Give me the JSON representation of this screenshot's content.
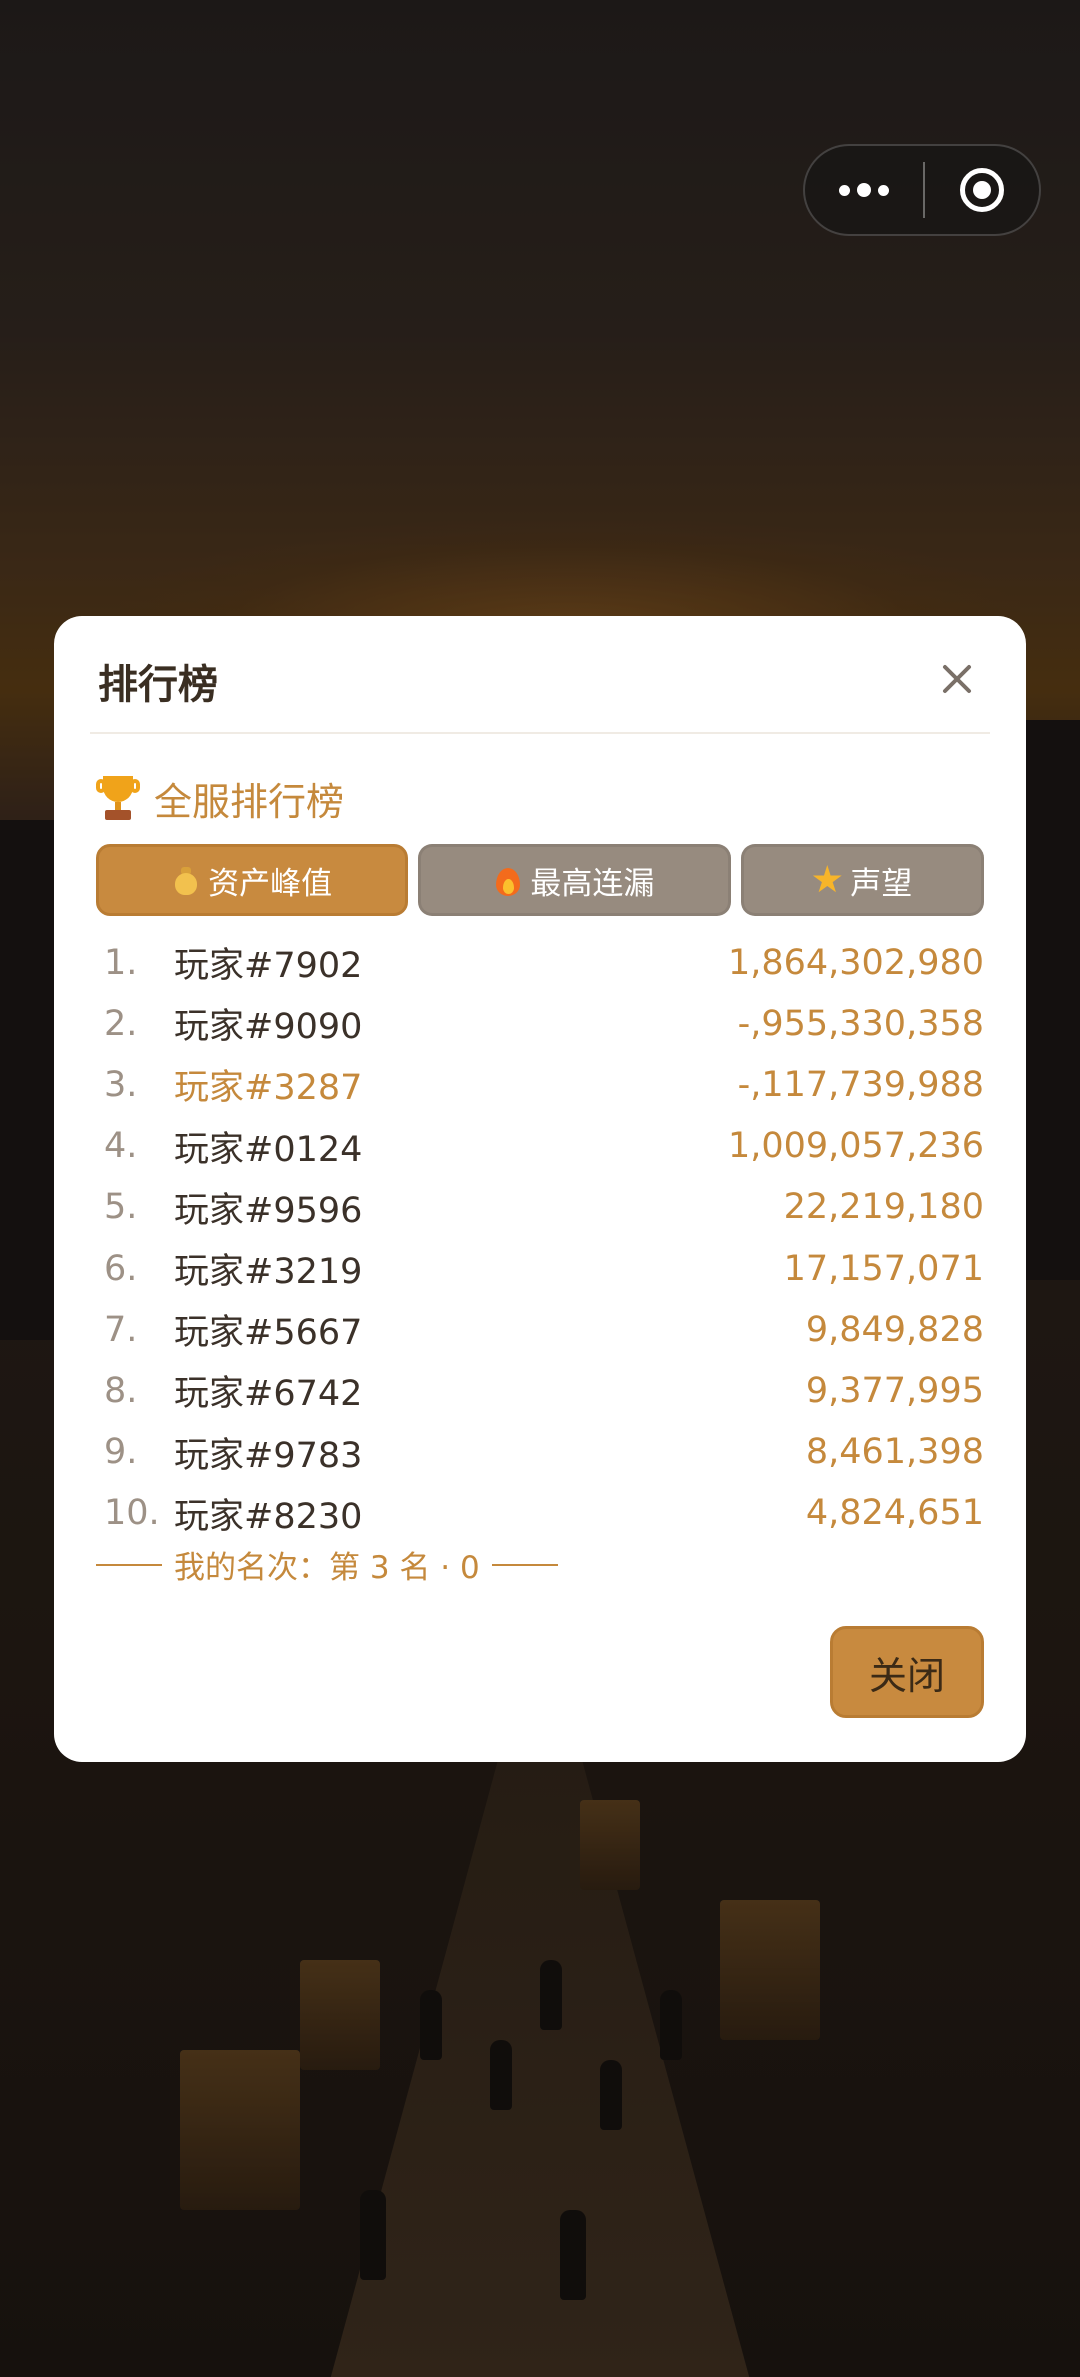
{
  "modal": {
    "title": "排行榜",
    "board_title": "全服排行榜",
    "tabs": [
      {
        "label": "资产峰值",
        "icon": "money-bag-icon",
        "active": true
      },
      {
        "label": "最高连漏",
        "icon": "fire-icon",
        "active": false
      },
      {
        "label": "声望",
        "icon": "star-icon",
        "active": false
      }
    ],
    "rankings": [
      {
        "rank": "1.",
        "player": "玩家#7902",
        "score": "1,864,302,980"
      },
      {
        "rank": "2.",
        "player": "玩家#9090",
        "score": "-,955,330,358"
      },
      {
        "rank": "3.",
        "player": "玩家#3287",
        "score": "-,117,739,988",
        "is_me": true
      },
      {
        "rank": "4.",
        "player": "玩家#0124",
        "score": "1,009,057,236"
      },
      {
        "rank": "5.",
        "player": "玩家#9596",
        "score": "22,219,180"
      },
      {
        "rank": "6.",
        "player": "玩家#3219",
        "score": "17,157,071"
      },
      {
        "rank": "7.",
        "player": "玩家#5667",
        "score": "9,849,828"
      },
      {
        "rank": "8.",
        "player": "玩家#6742",
        "score": "9,377,995"
      },
      {
        "rank": "9.",
        "player": "玩家#9783",
        "score": "8,461,398"
      },
      {
        "rank": "10.",
        "player": "玩家#8230",
        "score": "4,824,651"
      }
    ],
    "my_rank_text": "我的名次：第 3 名 · 0",
    "close_button_label": "关闭"
  },
  "colors": {
    "accent": "#c88a3f",
    "accent_text": "#c5893c",
    "tab_inactive": "#978b7f"
  },
  "capsule": {
    "more_icon": "more-dots-icon",
    "close_icon": "target-circle-icon"
  }
}
